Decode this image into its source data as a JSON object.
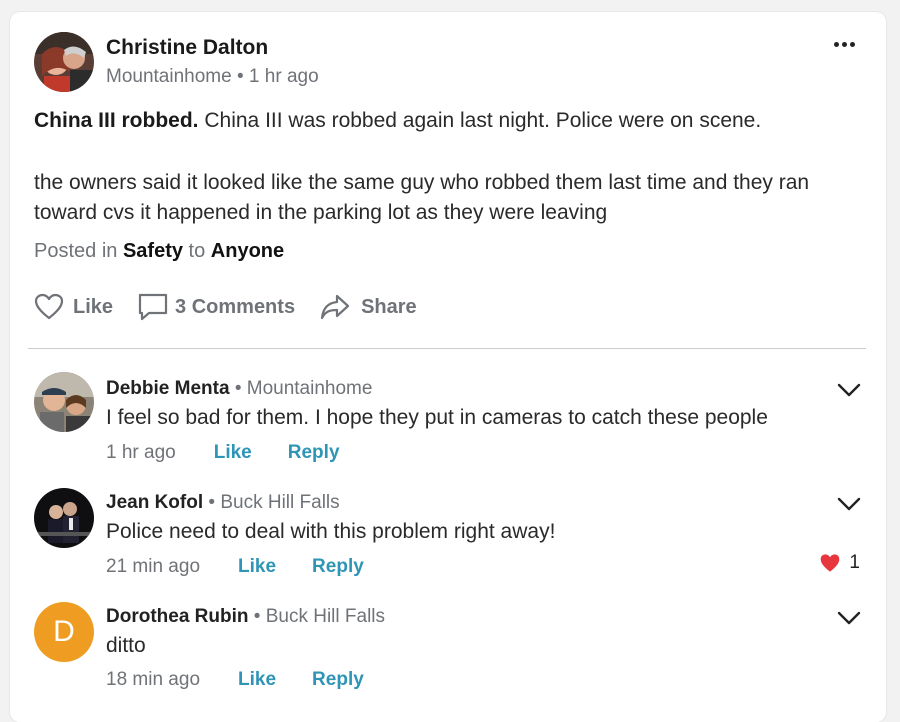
{
  "post": {
    "author": "Christine Dalton",
    "location": "Mountainhome",
    "separator": "•",
    "time": "1 hr ago",
    "title": "China III robbed.",
    "body_line1": "China III was robbed again last night. Police were on scene.",
    "body_para2": "the owners said  it looked like the same guy who robbed them last time  and they ran toward cvs it happened in the parking lot as they were leaving",
    "posted_in_label": "Posted in",
    "category": "Safety",
    "to_label": "to",
    "audience": "Anyone"
  },
  "actions": {
    "like": "Like",
    "comments": "3 Comments",
    "share": "Share"
  },
  "comments": [
    {
      "name": "Debbie Menta",
      "location": "Mountainhome",
      "text": "I feel so bad for them. I hope they put in cameras to catch these people",
      "time": "1 hr ago",
      "like": "Like",
      "reply": "Reply"
    },
    {
      "name": "Jean Kofol",
      "location": "Buck Hill Falls",
      "text": "Police need to deal with this problem right away!",
      "time": "21 min ago",
      "like": "Like",
      "reply": "Reply",
      "reaction_count": "1"
    },
    {
      "name": "Dorothea Rubin",
      "location": "Buck Hill Falls",
      "avatar_letter": "D",
      "text": "ditto",
      "time": "18 min ago",
      "like": "Like",
      "reply": "Reply"
    }
  ],
  "icons": {
    "more": "more-horizontal-icon",
    "like": "heart-outline-icon",
    "comments": "speech-bubble-icon",
    "share": "share-arrow-icon",
    "expand": "chevron-down-icon",
    "reaction": "heart-filled-icon"
  },
  "colors": {
    "link": "#2f95b5",
    "muted": "#6f7378",
    "reaction_heart": "#e8363f",
    "letter_avatar": "#ef9d22"
  }
}
